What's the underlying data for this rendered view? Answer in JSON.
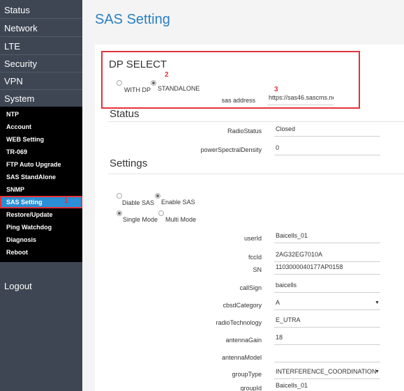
{
  "sidebar": {
    "main_items": [
      "Status",
      "Network",
      "LTE",
      "Security",
      "VPN",
      "System"
    ],
    "sub_items": [
      "NTP",
      "Account",
      "WEB Setting",
      "TR-069",
      "FTP Auto Upgrade",
      "SAS StandAlone",
      "SNMP",
      "SAS Setting",
      "Restore/Update",
      "Ping Watchdog",
      "Diagnosis",
      "Reboot"
    ],
    "active_sub": "SAS Setting",
    "logout": "Logout"
  },
  "page": {
    "title": "SAS Setting"
  },
  "dp_select": {
    "title": "DP SELECT",
    "with_dp": "WITH DP",
    "standalone": "STANDALONE",
    "selected": "STANDALONE",
    "sas_address_label": "sas address",
    "sas_address_value": "https://sas46.sascms.net/"
  },
  "status": {
    "title": "Status",
    "radio_status_label": "RadioStatus",
    "radio_status_value": "Closed",
    "psd_label": "powerSpectralDensity",
    "psd_value": "0"
  },
  "settings": {
    "title": "Settings",
    "disable_sas": "Diable SAS",
    "enable_sas": "Enable SAS",
    "sas_selected": "Enable SAS",
    "single_mode": "Single Mode",
    "multi_mode": "Multi Mode",
    "mode_selected": "Single Mode",
    "fields": {
      "userId": {
        "label": "userId",
        "value": "Baicells_01"
      },
      "fccId": {
        "label": "fccId",
        "value": "2AG32EG7010A"
      },
      "sn": {
        "label": "SN",
        "value": "1103000040177AP0158"
      },
      "callSign": {
        "label": "callSign",
        "value": "baicells"
      },
      "cbsdCategory": {
        "label": "cbsdCategory",
        "value": "A"
      },
      "radioTechnology": {
        "label": "radioTechnology",
        "value": "E_UTRA"
      },
      "antennaGain": {
        "label": "antennaGain",
        "value": "18"
      },
      "antennaModel": {
        "label": "antennaModel",
        "value": ""
      },
      "groupType": {
        "label": "groupType",
        "value": "INTERFERENCE_COORDINATION"
      },
      "groupId": {
        "label": "groupId",
        "value": "Baicells_01"
      }
    }
  },
  "annotations": {
    "a1": "1",
    "a2": "2",
    "a3": "3"
  },
  "colors": {
    "sidebar_bg": "#3d4652",
    "active_bg": "#2a8fd6",
    "highlight": "#e0333a",
    "title": "#2a7fc0"
  }
}
